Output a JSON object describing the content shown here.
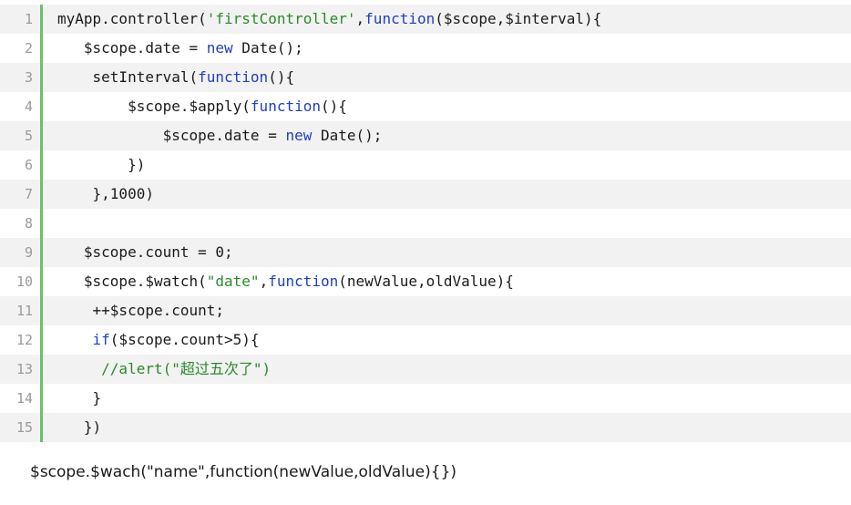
{
  "code": {
    "lines": [
      {
        "no": "1",
        "segments": [
          {
            "t": "myApp.controller(",
            "c": ""
          },
          {
            "t": "'firstController'",
            "c": "str"
          },
          {
            "t": ",",
            "c": ""
          },
          {
            "t": "function",
            "c": "kw"
          },
          {
            "t": "($scope,$interval){",
            "c": ""
          }
        ]
      },
      {
        "no": "2",
        "segments": [
          {
            "t": "   $scope.date = ",
            "c": ""
          },
          {
            "t": "new",
            "c": "kw"
          },
          {
            "t": " Date();",
            "c": ""
          }
        ]
      },
      {
        "no": "3",
        "segments": [
          {
            "t": "    setInterval(",
            "c": ""
          },
          {
            "t": "function",
            "c": "kw"
          },
          {
            "t": "(){",
            "c": ""
          }
        ]
      },
      {
        "no": "4",
        "segments": [
          {
            "t": "        $scope.$apply(",
            "c": ""
          },
          {
            "t": "function",
            "c": "kw"
          },
          {
            "t": "(){",
            "c": ""
          }
        ]
      },
      {
        "no": "5",
        "segments": [
          {
            "t": "            $scope.date = ",
            "c": ""
          },
          {
            "t": "new",
            "c": "kw"
          },
          {
            "t": " Date();",
            "c": ""
          }
        ]
      },
      {
        "no": "6",
        "segments": [
          {
            "t": "        })",
            "c": ""
          }
        ]
      },
      {
        "no": "7",
        "segments": [
          {
            "t": "    },1000)",
            "c": ""
          }
        ]
      },
      {
        "no": "8",
        "segments": [
          {
            "t": "",
            "c": ""
          }
        ]
      },
      {
        "no": "9",
        "segments": [
          {
            "t": "   $scope.count = 0;",
            "c": ""
          }
        ]
      },
      {
        "no": "10",
        "segments": [
          {
            "t": "   $scope.$watch(",
            "c": ""
          },
          {
            "t": "\"date\"",
            "c": "str"
          },
          {
            "t": ",",
            "c": ""
          },
          {
            "t": "function",
            "c": "kw"
          },
          {
            "t": "(newValue,oldValue){",
            "c": ""
          }
        ]
      },
      {
        "no": "11",
        "segments": [
          {
            "t": "    ++$scope.count;",
            "c": ""
          }
        ]
      },
      {
        "no": "12",
        "segments": [
          {
            "t": "    ",
            "c": ""
          },
          {
            "t": "if",
            "c": "kw"
          },
          {
            "t": "($scope.count>5){",
            "c": ""
          }
        ]
      },
      {
        "no": "13",
        "segments": [
          {
            "t": "     //alert(\"超过五次了\")",
            "c": "cmt"
          }
        ]
      },
      {
        "no": "14",
        "segments": [
          {
            "t": "    }",
            "c": ""
          }
        ]
      },
      {
        "no": "15",
        "segments": [
          {
            "t": "   })",
            "c": ""
          }
        ]
      }
    ]
  },
  "caption": {
    "text": "$scope.$wach(\"name\",function(newValue,oldValue){})"
  },
  "colors": {
    "keyword": "#1f3fbf",
    "string": "#2a8a2a",
    "gutter_accent": "#6ac16a",
    "stripe": "#f2f2f2"
  }
}
